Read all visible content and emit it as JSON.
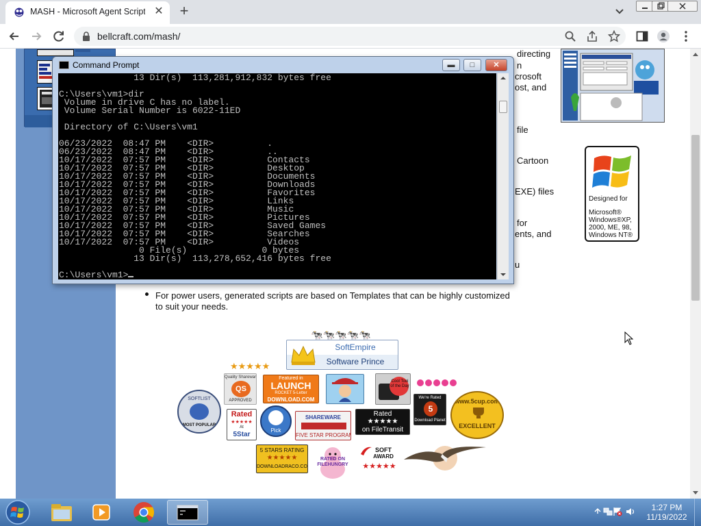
{
  "browser": {
    "tab": {
      "title": "MASH - Microsoft Agent Scripting Helper",
      "close_glyph": "✕"
    },
    "new_tab_glyph": "+",
    "url": "bellcraft.com/mash/"
  },
  "cmd": {
    "title": "Command Prompt",
    "controls": {
      "minimize": "▬",
      "maximize": "□",
      "close": "✕"
    },
    "lines": [
      "              13 Dir(s)  113,281,912,832 bytes free",
      "",
      "C:\\Users\\vm1>dir",
      " Volume in drive C has no label.",
      " Volume Serial Number is 6022-11ED",
      "",
      " Directory of C:\\Users\\vm1",
      "",
      "06/23/2022  08:47 PM    <DIR>          .",
      "06/23/2022  08:47 PM    <DIR>          ..",
      "10/17/2022  07:57 PM    <DIR>          Contacts",
      "10/17/2022  07:57 PM    <DIR>          Desktop",
      "10/17/2022  07:57 PM    <DIR>          Documents",
      "10/17/2022  07:57 PM    <DIR>          Downloads",
      "10/17/2022  07:57 PM    <DIR>          Favorites",
      "10/17/2022  07:57 PM    <DIR>          Links",
      "10/17/2022  07:57 PM    <DIR>          Music",
      "10/17/2022  07:57 PM    <DIR>          Pictures",
      "10/17/2022  07:57 PM    <DIR>          Saved Games",
      "10/17/2022  07:57 PM    <DIR>          Searches",
      "10/17/2022  07:57 PM    <DIR>          Videos",
      "               0 File(s)              0 bytes",
      "              13 Dir(s)  113,278,652,416 bytes free",
      "",
      "C:\\Users\\vm1>"
    ]
  },
  "page": {
    "fragments": [
      "directing",
      "n",
      "crosoft",
      "ost, and",
      "file",
      "Cartoon",
      "EXE) files",
      "for",
      "ents, and",
      "u"
    ],
    "bullet_text_1": "For power users, generated scripts are based on Templates that can be highly customized",
    "bullet_text_2": "to suit your needs.",
    "xp_badge": {
      "designed_for": "Designed for",
      "line1": "Microsoft®",
      "line2": "Windows®XP,",
      "line3": "2000, ME, 98,",
      "line4": "Windows NT®"
    },
    "awards": {
      "cows": "🐄🐄🐄🐄🐄",
      "softempire_top": "SoftEmpire",
      "softempire_bottom": "Software Prince",
      "stars5": "★★★★★",
      "qs_top": "Quality Shareware",
      "qs_mid": "QS",
      "qs_bottom": "APPROVED",
      "launch_top": "Featured in",
      "launch_mid": "LAUNCH",
      "launch_sub": "ROCKET  5-Letter",
      "launch_bottom": "DOWNLOAD.COM",
      "cool_text": "Cool Tool of the Day",
      "softlist_top": "SOFTLIST",
      "softlist_bottom": "MOST POPULAR",
      "rated5_top": "Rated",
      "rated5_mid": "★★★★★",
      "rated5_at": "At",
      "rated5_bottom": "5Star",
      "pick_text": "Pick",
      "five_star_top": "SHAREWARE",
      "five_star_bottom": "FIVE STAR PROGRAM",
      "filetransit_top": "Rated",
      "filetransit_stars": "★★★★★",
      "filetransit_bottom": "on FileTransit",
      "dlplanet_top": "We're Rated",
      "dlplanet_num": "5",
      "dlplanet_bottom": "Download Planet",
      "excellent_top": "www.5cup.com",
      "excellent_bottom": "EXCELLENT",
      "starsrating_top": "5 STARS RATING",
      "starsrating_bottom": "DOWNLOADRACO.COM",
      "pig_text": "RATED ON FILEHUNGRY",
      "softaward_top": "SOFT",
      "softaward_bottom": "AWARD"
    }
  },
  "taskbar": {
    "time": "1:27 PM",
    "date": "11/19/2022"
  }
}
